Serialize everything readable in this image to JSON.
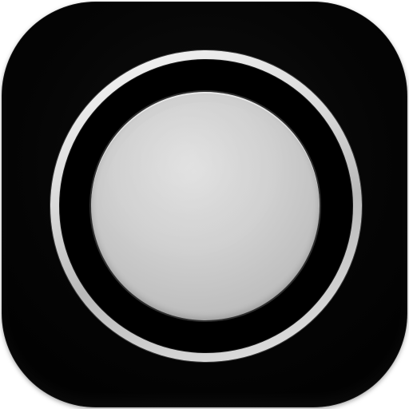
{
  "app_icon": {
    "icon_name": "record-button-icon",
    "colors": {
      "background": "#000000",
      "ring": "#d6d6d6",
      "disc": "#c7c7c7"
    }
  }
}
